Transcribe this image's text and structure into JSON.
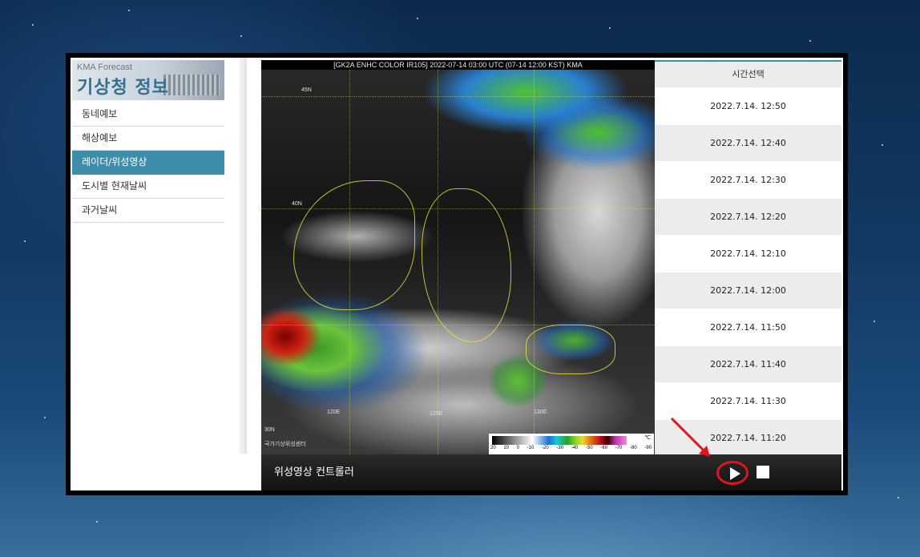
{
  "logo": {
    "small": "KMA Forecast",
    "big": "기상청 정보"
  },
  "menu": {
    "items": [
      {
        "label": "동네예보"
      },
      {
        "label": "해상예보"
      },
      {
        "label": "레이더/위성영상"
      },
      {
        "label": "도시별 현재날씨"
      },
      {
        "label": "과거날씨"
      }
    ],
    "active_index": 2
  },
  "satellite": {
    "title": "[GK2A ENHC COLOR IR105]  2022-07-14 03:00 UTC (07-14 12:00 KST) KMA",
    "lat_labels": [
      "45N",
      "40N",
      "30N"
    ],
    "lon_labels": [
      "120E",
      "125E",
      "130E"
    ],
    "colorbar_ticks": "20 10 0 -10 -20 -30 -40 -50 -60 -70 -80 -90",
    "colorbar_unit": "℃",
    "agency": "국가기상위성센터"
  },
  "timelist": {
    "header": "시간선택",
    "times": [
      "2022.7.14. 12:50",
      "2022.7.14. 12:40",
      "2022.7.14. 12:30",
      "2022.7.14. 12:20",
      "2022.7.14. 12:10",
      "2022.7.14. 12:00",
      "2022.7.14. 11:50",
      "2022.7.14. 11:40",
      "2022.7.14. 11:30",
      "2022.7.14. 11:20"
    ]
  },
  "controller": {
    "label": "위성영상 컨트롤러"
  },
  "colors": {
    "accent": "#3d8dab",
    "highlight": "#e0141b"
  }
}
